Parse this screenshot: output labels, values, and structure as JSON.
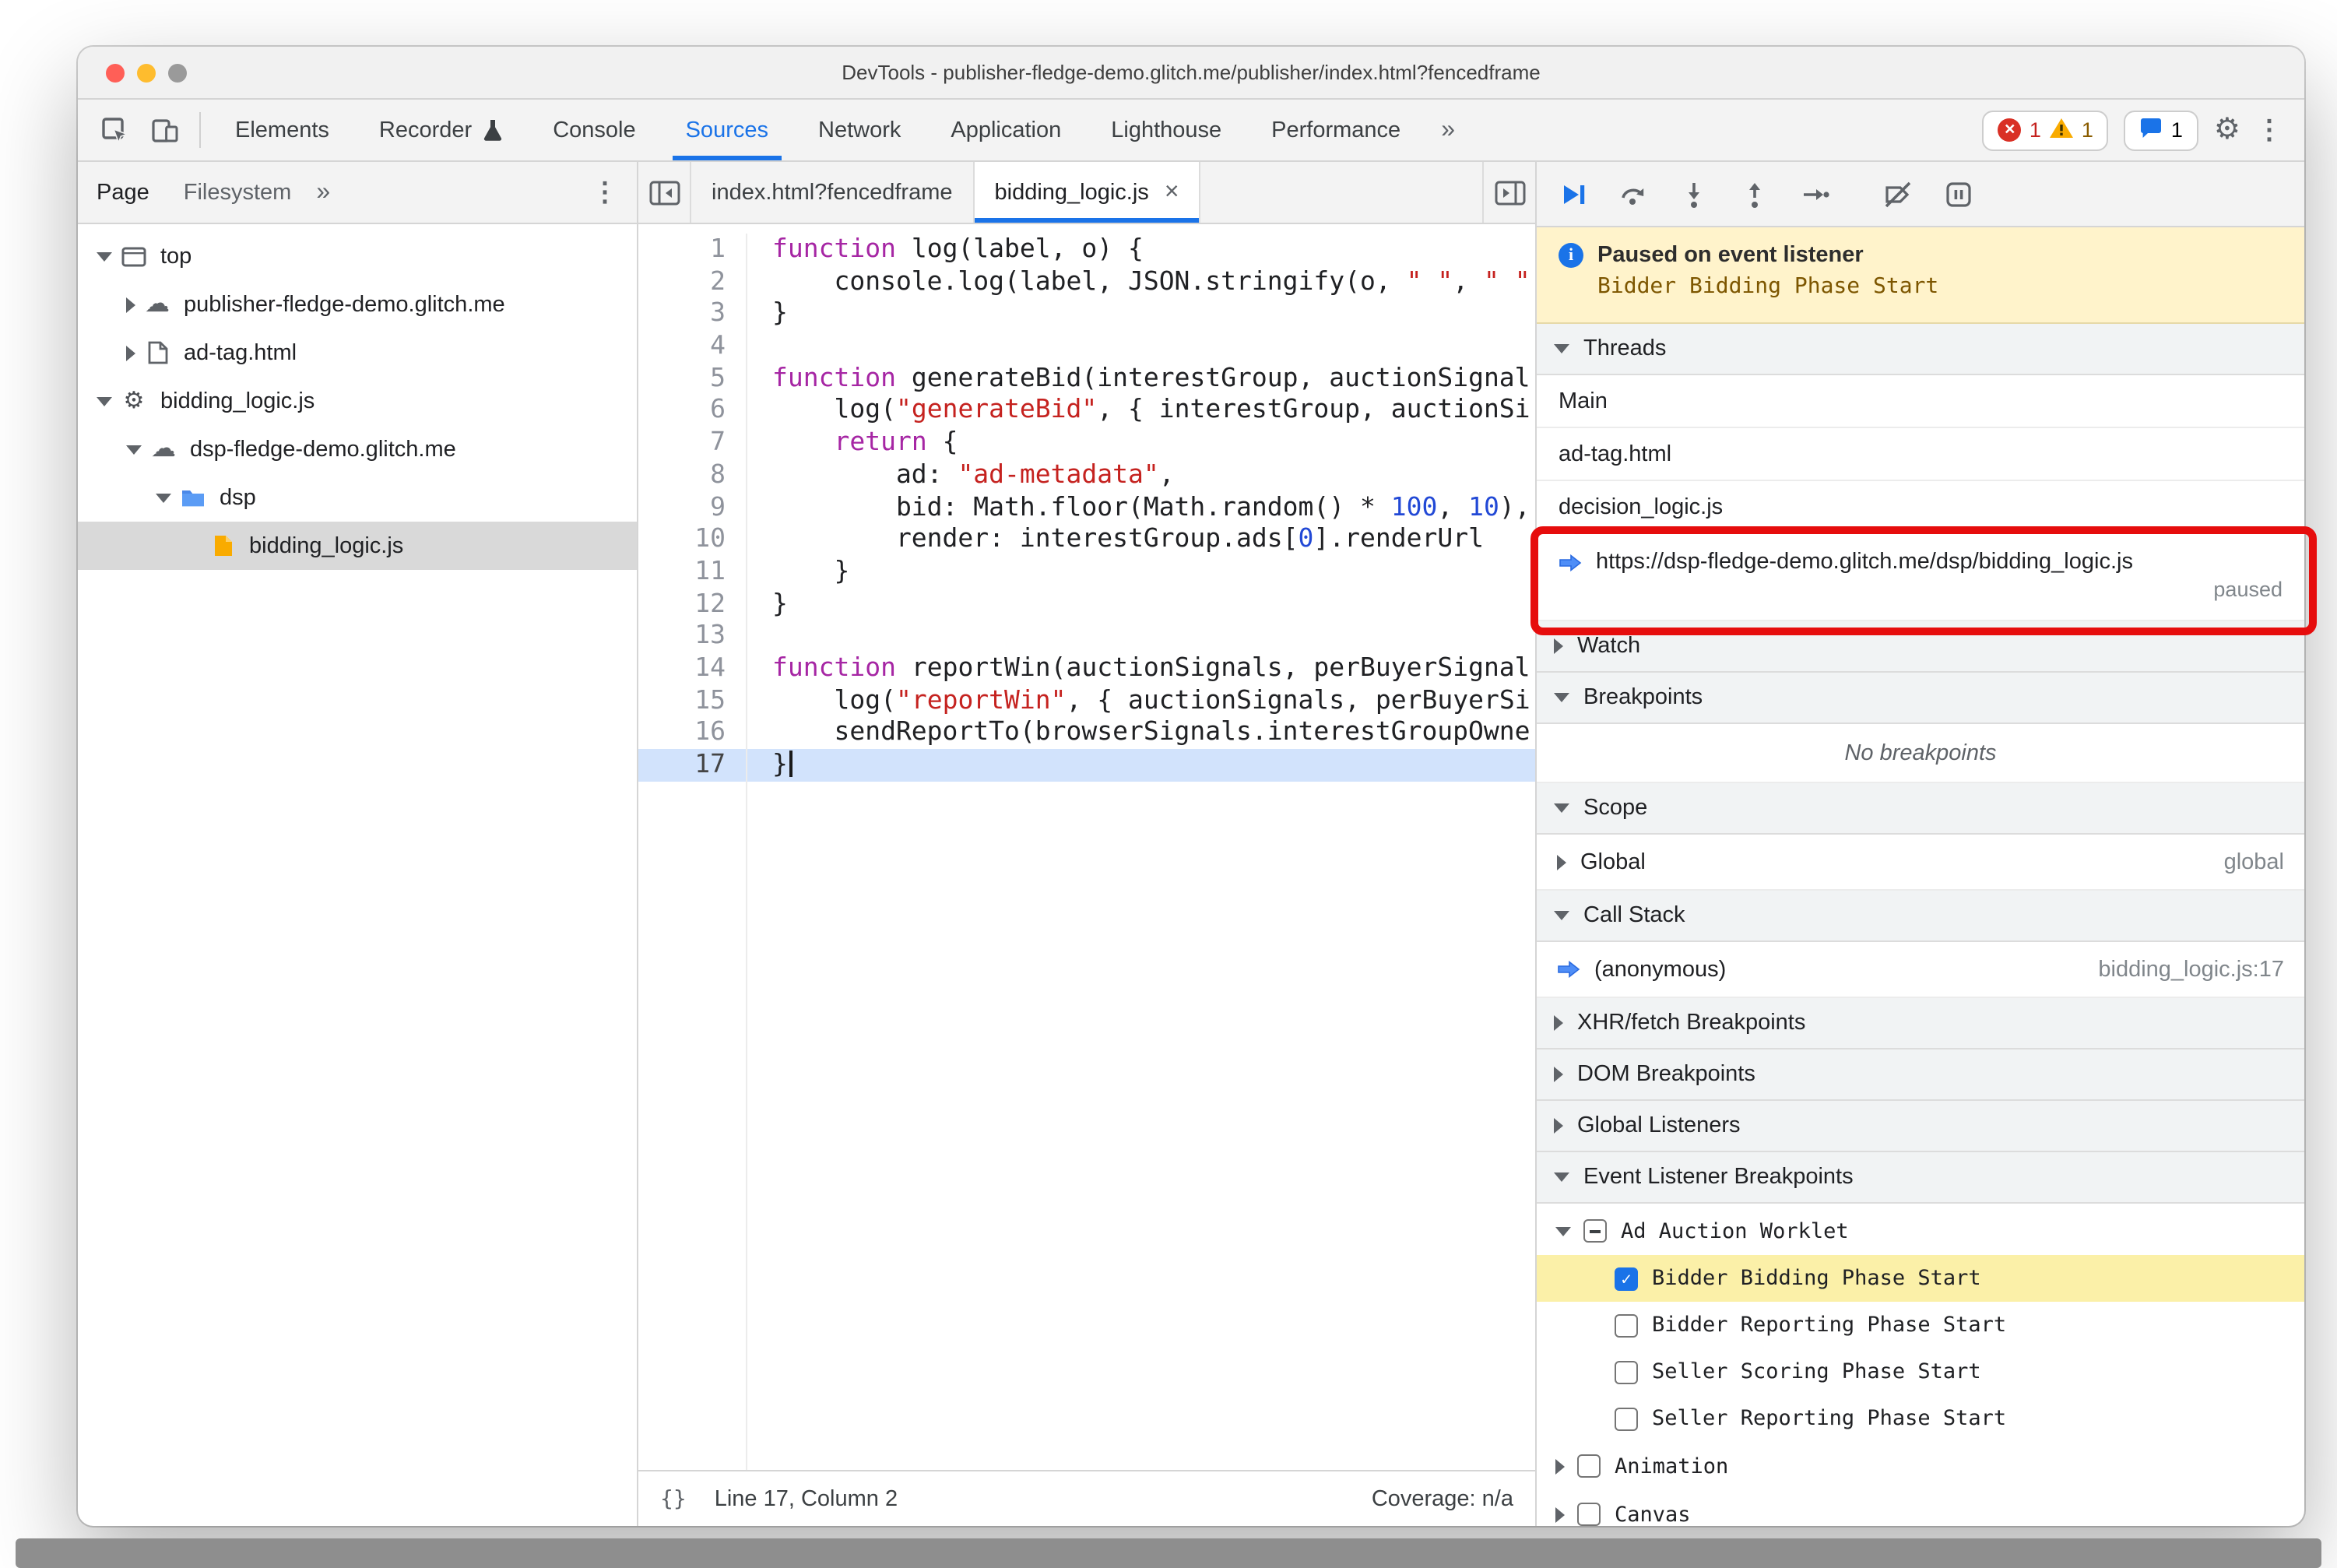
{
  "colors": {
    "accent": "#1a73e8",
    "error": "#d93025",
    "warning": "#f9ab00",
    "annotation": "#e60d0d",
    "paused_banner": "#fff3cb",
    "active_line": "#d2e3fc"
  },
  "window": {
    "title": "DevTools - publisher-fledge-demo.glitch.me/publisher/index.html?fencedframe"
  },
  "main_tabs": {
    "items": [
      "Elements",
      "Recorder",
      "Console",
      "Sources",
      "Network",
      "Application",
      "Lighthouse",
      "Performance"
    ],
    "active": "Sources",
    "overflow": "»",
    "error_count": "1",
    "warning_count": "1",
    "issue_count": "1"
  },
  "navigator": {
    "tabs": {
      "page": "Page",
      "filesystem": "Filesystem",
      "more": "»"
    },
    "tree": [
      {
        "depth": 0,
        "arrow": "down",
        "icon": "frame-icon",
        "label": "top"
      },
      {
        "depth": 1,
        "arrow": "right",
        "icon": "cloud-icon",
        "label": "publisher-fledge-demo.glitch.me"
      },
      {
        "depth": 1,
        "arrow": "right",
        "icon": "page-icon",
        "label": "ad-tag.html"
      },
      {
        "depth": 0,
        "arrow": "down",
        "icon": "gear-icon",
        "label": "bidding_logic.js"
      },
      {
        "depth": 1,
        "arrow": "down",
        "icon": "cloud-icon",
        "label": "dsp-fledge-demo.glitch.me"
      },
      {
        "depth": 2,
        "arrow": "down",
        "icon": "folder-icon",
        "label": "dsp"
      },
      {
        "depth": 3,
        "arrow": "none",
        "icon": "js-file-icon",
        "label": "bidding_logic.js",
        "selected": true
      }
    ]
  },
  "editor": {
    "tabs": [
      {
        "label": "index.html?fencedframe",
        "active": false
      },
      {
        "label": "bidding_logic.js",
        "active": true,
        "close": "×"
      }
    ],
    "code": [
      {
        "n": 1,
        "t": [
          [
            "k",
            "function"
          ],
          [
            "d",
            " log(label, o) {"
          ]
        ]
      },
      {
        "n": 2,
        "t": [
          [
            "d",
            "    console.log(label, JSON.stringify(o, "
          ],
          [
            "s",
            "\" \""
          ],
          [
            "d",
            ", "
          ],
          [
            "s",
            "\" \""
          ]
        ]
      },
      {
        "n": 3,
        "t": [
          [
            "d",
            "}"
          ]
        ]
      },
      {
        "n": 4,
        "t": []
      },
      {
        "n": 5,
        "t": [
          [
            "k",
            "function"
          ],
          [
            "d",
            " generateBid(interestGroup, auctionSignal"
          ]
        ]
      },
      {
        "n": 6,
        "t": [
          [
            "d",
            "    log("
          ],
          [
            "s",
            "\"generateBid\""
          ],
          [
            "d",
            ", { interestGroup, auctionSi"
          ]
        ]
      },
      {
        "n": 7,
        "t": [
          [
            "d",
            "    "
          ],
          [
            "k",
            "return"
          ],
          [
            "d",
            " {"
          ]
        ]
      },
      {
        "n": 8,
        "t": [
          [
            "d",
            "        ad: "
          ],
          [
            "s",
            "\"ad-metadata\""
          ],
          [
            "d",
            ","
          ]
        ]
      },
      {
        "n": 9,
        "t": [
          [
            "d",
            "        bid: Math.floor(Math.random() * "
          ],
          [
            "n",
            "100"
          ],
          [
            "d",
            ", "
          ],
          [
            "n",
            "10"
          ],
          [
            "d",
            "),"
          ]
        ]
      },
      {
        "n": 10,
        "t": [
          [
            "d",
            "        render: interestGroup.ads["
          ],
          [
            "n",
            "0"
          ],
          [
            "d",
            "].renderUrl"
          ]
        ]
      },
      {
        "n": 11,
        "t": [
          [
            "d",
            "    }"
          ]
        ]
      },
      {
        "n": 12,
        "t": [
          [
            "d",
            "}"
          ]
        ]
      },
      {
        "n": 13,
        "t": []
      },
      {
        "n": 14,
        "t": [
          [
            "k",
            "function"
          ],
          [
            "d",
            " reportWin(auctionSignals, perBuyerSignal"
          ]
        ]
      },
      {
        "n": 15,
        "t": [
          [
            "d",
            "    log("
          ],
          [
            "s",
            "\"reportWin\""
          ],
          [
            "d",
            ", { auctionSignals, perBuyerSi"
          ]
        ]
      },
      {
        "n": 16,
        "t": [
          [
            "d",
            "    sendReportTo(browserSignals.interestGroupOwne"
          ]
        ]
      },
      {
        "n": 17,
        "t": [
          [
            "d",
            "}"
          ]
        ],
        "current": true
      }
    ],
    "status": {
      "braces": "{}",
      "position": "Line 17, Column 2",
      "coverage": "Coverage: n/a"
    }
  },
  "debugger": {
    "paused": {
      "title": "Paused on event listener",
      "event": "Bidder Bidding Phase Start"
    },
    "sections": {
      "threads": "Threads",
      "watch": "Watch",
      "breakpoints": "Breakpoints",
      "scope": "Scope",
      "call_stack": "Call Stack",
      "xhr": "XHR/fetch Breakpoints",
      "dom": "DOM Breakpoints",
      "global_listeners": "Global Listeners",
      "event_listener_breakpoints": "Event Listener Breakpoints"
    },
    "threads": [
      {
        "label": "Main"
      },
      {
        "label": "ad-tag.html"
      },
      {
        "label": "decision_logic.js"
      },
      {
        "label": "https://dsp-fledge-demo.glitch.me/dsp/bidding_logic.js",
        "active": true,
        "status": "paused"
      }
    ],
    "breakpoints_empty": "No breakpoints",
    "scope_row": {
      "label": "Global",
      "hint": "global"
    },
    "call_stack_row": {
      "label": "(anonymous)",
      "location": "bidding_logic.js:17"
    },
    "event_groups": [
      {
        "label": "Ad Auction Worklet",
        "arrow": "down",
        "state": "indeterminate",
        "children": [
          {
            "label": "Bidder Bidding Phase Start",
            "checked": true,
            "highlighted": true
          },
          {
            "label": "Bidder Reporting Phase Start",
            "checked": false
          },
          {
            "label": "Seller Scoring Phase Start",
            "checked": false
          },
          {
            "label": "Seller Reporting Phase Start",
            "checked": false
          }
        ]
      },
      {
        "label": "Animation",
        "arrow": "right",
        "state": "unchecked",
        "children": []
      },
      {
        "label": "Canvas",
        "arrow": "right",
        "state": "unchecked",
        "children": []
      }
    ]
  }
}
